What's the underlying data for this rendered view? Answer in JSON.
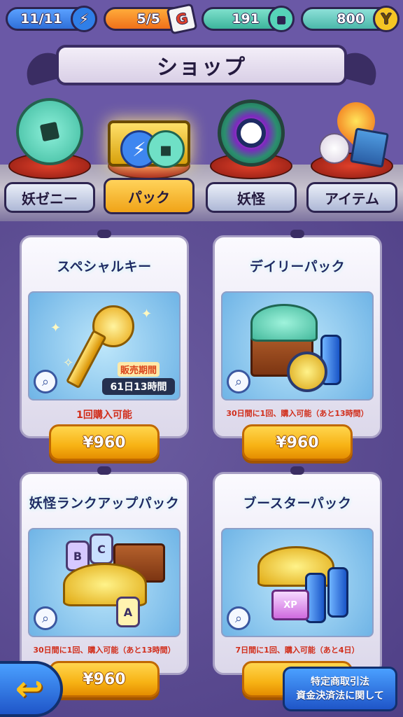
{
  "status_bar": {
    "stamina": "11/11",
    "tickets": "5/5",
    "coins": "191",
    "money": "800",
    "icons": {
      "stamina": "bolt-icon",
      "tickets": "ticket-icon",
      "coins": "zeni-coin-icon",
      "money": "yen-coin-icon"
    }
  },
  "header": {
    "title": "ショップ"
  },
  "categories": [
    {
      "label": "妖ゼニー",
      "icon": "zeni-coin-icon",
      "active": false
    },
    {
      "label": "パック",
      "icon": "pack-box-icon",
      "active": true
    },
    {
      "label": "妖怪",
      "icon": "youkai-watch-icon",
      "active": false
    },
    {
      "label": "アイテム",
      "icon": "items-icon",
      "active": false
    }
  ],
  "products": [
    {
      "title": "スペシャルキー",
      "note": "1回購入可能",
      "price": "¥960",
      "sale_period_label": "販売期間",
      "sale_period_value": "61日13時間"
    },
    {
      "title": "デイリーパック",
      "note": "30日間に1回、購入可能（あと13時間）",
      "price": "¥960"
    },
    {
      "title": "妖怪ランクアップパック",
      "note": "30日間に1回、購入可能（あと13時間）",
      "price": "¥960"
    },
    {
      "title": "ブースターパック",
      "note": "7日間に1回、購入可能（あと4日）",
      "price": ""
    }
  ],
  "footer": {
    "legal_line1": "特定商取引法",
    "legal_line2": "資金決済法に関して"
  },
  "colors": {
    "background": "#5b4a8e",
    "accent_gold": "#f7b214",
    "title_text": "#1e2b64",
    "note_text": "#d12d1a"
  }
}
